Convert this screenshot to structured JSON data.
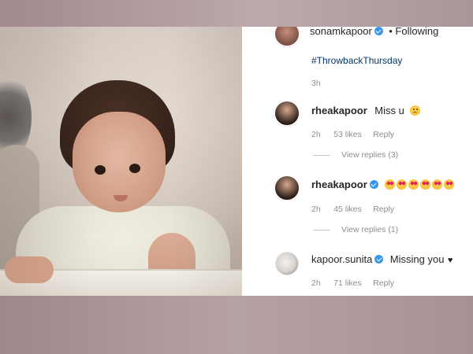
{
  "post": {
    "author": {
      "username": "sonamkapoor",
      "verified": true,
      "follow_state": "• Following"
    },
    "caption_tag": "#ThrowbackThursday",
    "caption_time": "3h"
  },
  "comments": [
    {
      "username": "rheakapoor",
      "verified": false,
      "text": "Miss u",
      "emoji": [
        "sad-face"
      ],
      "time": "2h",
      "likes": "53 likes",
      "reply": "Reply",
      "view_replies": "View replies (3)"
    },
    {
      "username": "rheakapoor",
      "verified": true,
      "text": "",
      "emoji": [
        "heart-eyes",
        "heart-eyes",
        "heart-eyes",
        "heart-eyes",
        "heart-eyes",
        "heart-eyes"
      ],
      "time": "2h",
      "likes": "45 likes",
      "reply": "Reply",
      "view_replies": "View replies (1)"
    },
    {
      "username": "kapoor.sunita",
      "verified": true,
      "text": "Missing you",
      "trailing": "♥",
      "time": "2h",
      "likes": "71 likes",
      "reply": "Reply"
    }
  ],
  "colors": {
    "link": "#003569",
    "verified": "#3897f0",
    "muted": "#8e8e8e",
    "text": "#262626"
  }
}
